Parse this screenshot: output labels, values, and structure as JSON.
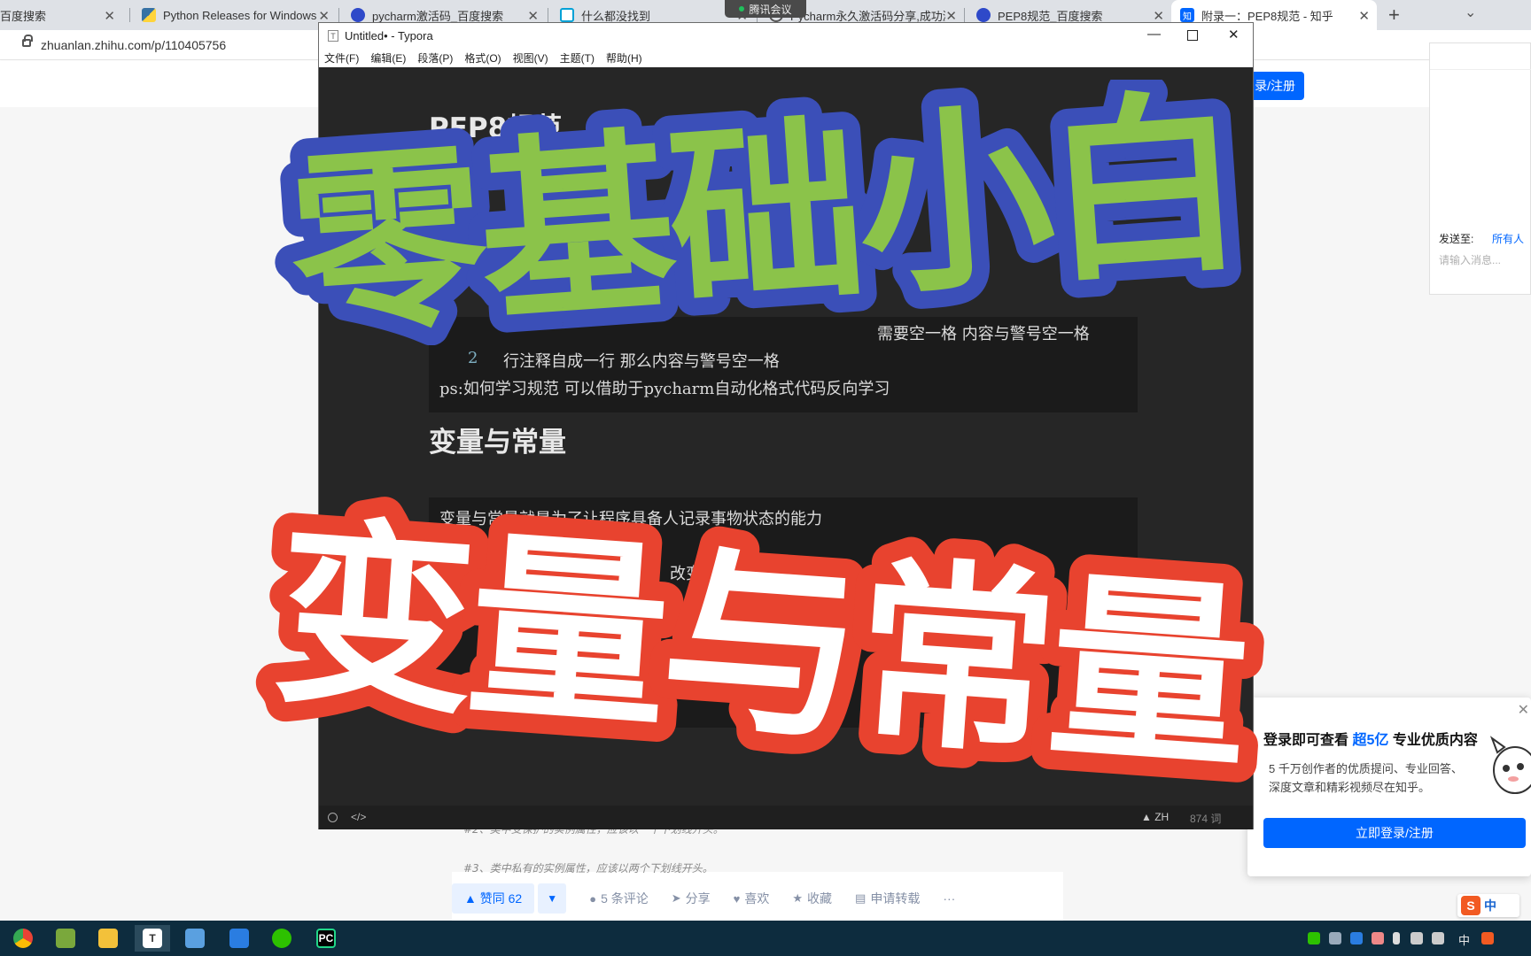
{
  "browser": {
    "tabs": [
      {
        "label": "百度搜索",
        "favicon": "paw-icon"
      },
      {
        "label": "Python Releases for Windows",
        "favicon": "python-icon"
      },
      {
        "label": "pycharm激活码_百度搜索",
        "favicon": "paw-icon"
      },
      {
        "label": "什么都没找到",
        "favicon": "bilibili-icon"
      },
      {
        "label": "Pycharm永久激活码分享,成功激",
        "favicon": "loading-icon"
      },
      {
        "label": "PEP8规范_百度搜索",
        "favicon": "paw-icon"
      },
      {
        "label": "附录一：PEP8规范 - 知乎",
        "favicon": "zhihu-icon"
      }
    ],
    "url": "zhuanlan.zhihu.com/p/110405756"
  },
  "meeting": {
    "label": "腾讯会议"
  },
  "zhihu": {
    "login_button": "录/注册",
    "code_lines": [
      "#2、类中受保护的实例属性，应该以一个下划线开头。",
      "#3、类中私有的实例属性，应该以两个下划线开头。"
    ],
    "vote_up": "▲ 赞同 62",
    "vote_down": "▼",
    "actions": [
      {
        "icon": "comment-icon",
        "label": "5 条评论"
      },
      {
        "icon": "share-icon",
        "label": "分享"
      },
      {
        "icon": "heart-icon",
        "label": "喜欢"
      },
      {
        "icon": "star-icon",
        "label": "收藏"
      },
      {
        "icon": "document-icon",
        "label": "申请转载"
      },
      {
        "icon": "more-icon",
        "label": "···"
      }
    ]
  },
  "chat": {
    "sendto_label": "发送至:",
    "sendto_target": "所有人",
    "input_placeholder": "请输入消息..."
  },
  "login_popup": {
    "title_pre": "登录即可查看",
    "title_highlight": "超5亿",
    "title_post": "专业优质内容",
    "desc": "5 千万创作者的优质提问、专业回答、深度文章和精彩视频尽在知乎。",
    "button": "立即登录/注册"
  },
  "typora": {
    "window_title": "Untitled• - Typora",
    "menu": [
      "文件(F)",
      "编辑(E)",
      "段落(P)",
      "格式(O)",
      "视图(V)",
      "主题(T)",
      "帮助(H)"
    ],
    "h1": "PEP8规范",
    "block1": {
      "line1": "需要空一格 内容与警号空一格",
      "line2_num": "2",
      "line2": "行注释自成一行 那么内容与警号空一格",
      "line3": "ps:如何学习规范 可以借助于pycharm自动化格式代码反向学习"
    },
    "h2": "变量与常量",
    "block2": {
      "line1": "变量与常量就是为了让程序具备人记录事物状态的能力",
      "line2": "改变）",
      "line3": "态"
    },
    "status": {
      "lang": "ZH",
      "words": "874 词"
    }
  },
  "overlay": {
    "top_text": "零基础小白",
    "bottom_text": "变量与常量"
  },
  "taskbar": {
    "apps": [
      "chrome-icon",
      "notepad-icon",
      "explorer-icon",
      "typora-icon",
      "computer-icon",
      "app-icon",
      "wechat-icon",
      "pycharm-icon"
    ],
    "tray_lang": "中",
    "sogou": "中"
  },
  "colors": {
    "overlay_green": "#8bc34a",
    "overlay_blue": "#3b4fb8",
    "overlay_red": "#e8432f",
    "zhihu_blue": "#0066ff"
  }
}
